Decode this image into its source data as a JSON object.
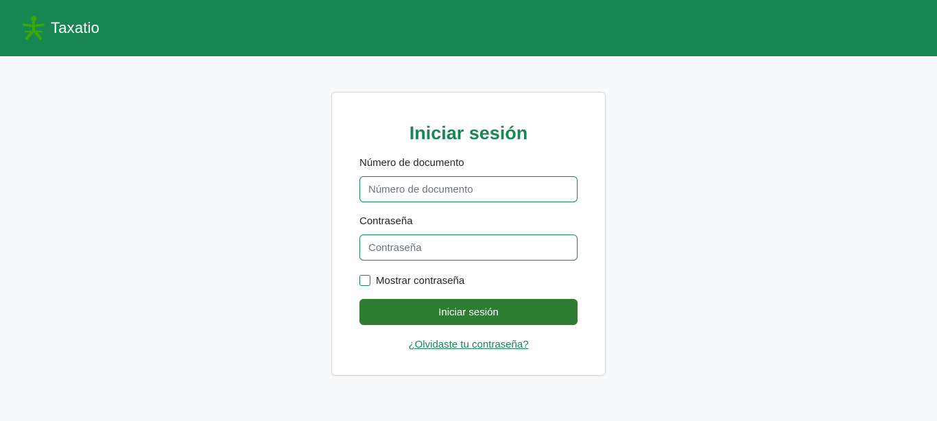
{
  "navbar": {
    "brand_name": "Taxatio",
    "logo_icon": "sena-logo-icon",
    "background": "#198754"
  },
  "login": {
    "title": "Iniciar sesión",
    "document_label": "Número de documento",
    "document_placeholder": "Número de documento",
    "document_value": "",
    "password_label": "Contraseña",
    "password_placeholder": "Contraseña",
    "password_value": "",
    "show_password_label": "Mostrar contraseña",
    "show_password_checked": false,
    "submit_label": "Iniciar sesión",
    "forgot_label": "¿Olvidaste tu contraseña?"
  },
  "colors": {
    "accent": "#198754",
    "button": "#2e7d32",
    "page_background": "#f8f9fa",
    "logo": "#39a900"
  }
}
